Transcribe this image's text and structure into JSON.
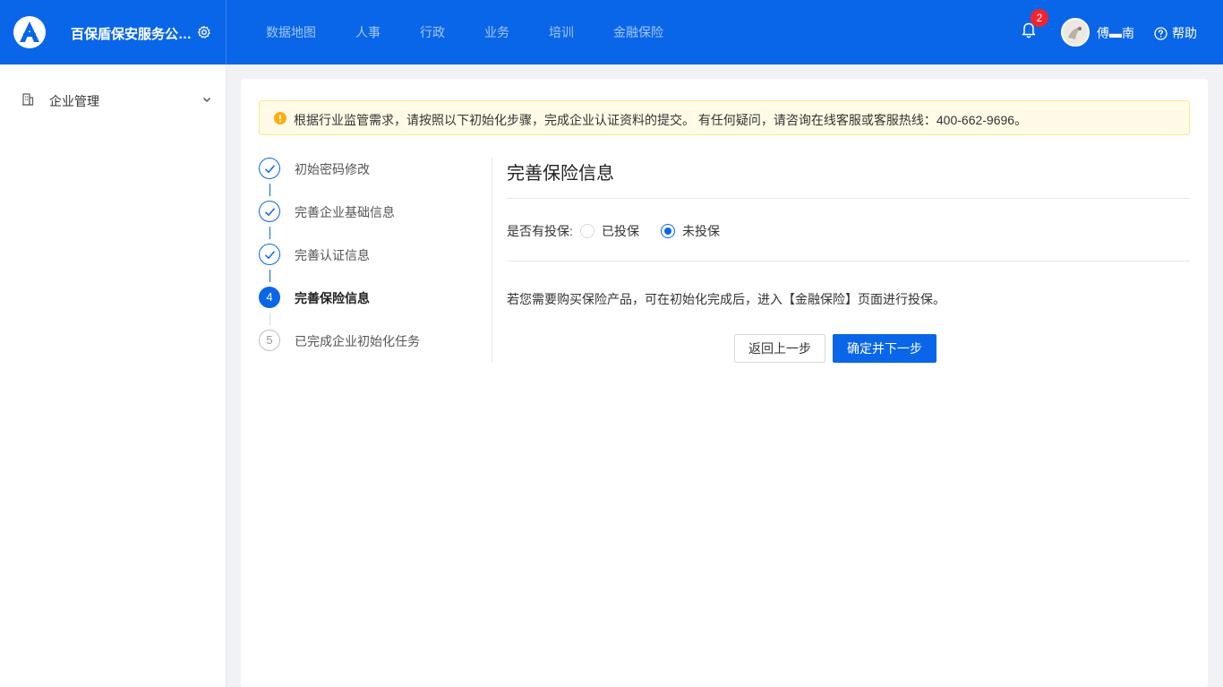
{
  "header": {
    "company": "百保盾保安服务公司...",
    "nav": [
      "数据地图",
      "人事",
      "行政",
      "业务",
      "培训",
      "金融保险"
    ],
    "notification_count": "2",
    "username": "傅▬南",
    "help_label": "帮助",
    "accent": "#0a66e8"
  },
  "sidebar": {
    "items": [
      {
        "label": "企业管理",
        "icon": "building-icon"
      }
    ]
  },
  "alert": {
    "text": "根据行业监管需求，请按照以下初始化步骤，完成企业认证资料的提交。 有任何疑问，请咨询在线客服或客服热线：400-662-9696。"
  },
  "steps": [
    {
      "label": "初始密码修改",
      "status": "finish"
    },
    {
      "label": "完善企业基础信息",
      "status": "finish"
    },
    {
      "label": "完善认证信息",
      "status": "finish"
    },
    {
      "label": "完善保险信息",
      "status": "process",
      "number": "4"
    },
    {
      "label": "已完成企业初始化任务",
      "status": "wait",
      "number": "5"
    }
  ],
  "form": {
    "title": "完善保险信息",
    "question": "是否有投保:",
    "options": [
      {
        "label": "已投保",
        "checked": false
      },
      {
        "label": "未投保",
        "checked": true
      }
    ],
    "tip": "若您需要购买保险产品，可在初始化完成后，进入【金融保险】页面进行投保。",
    "back_button": "返回上一步",
    "next_button": "确定并下一步"
  }
}
